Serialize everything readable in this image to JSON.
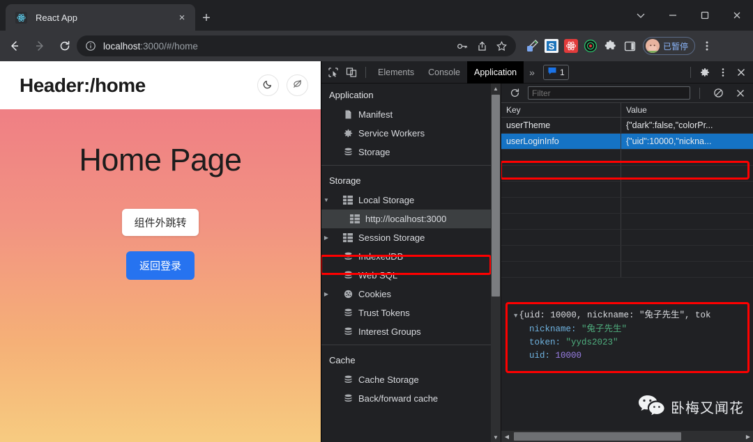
{
  "browser": {
    "tab": {
      "title": "React App",
      "favicon": "react-logo-icon",
      "close": "×"
    },
    "new_tab": "+",
    "window_controls": [
      "chevron-down",
      "minimize",
      "maximize",
      "close"
    ],
    "nav": {
      "back": "←",
      "forward": "→",
      "reload": "⟳"
    },
    "omnibox": {
      "info_icon": "info-circle-icon",
      "url_host": "localhost",
      "url_rest": ":3000/#/home",
      "icons": [
        "key-icon",
        "share-icon",
        "bookmark-star-icon"
      ]
    },
    "extensions": [
      "eyedropper-icon",
      "s-logo-icon",
      "react-devtools-icon",
      "target-icon",
      "puzzle-icon",
      "sidepanel-icon"
    ],
    "profile": {
      "label": "已暂停",
      "avatar": "avatar-icon"
    },
    "menu_icon": "kebab-menu-icon"
  },
  "page": {
    "header_title": "Header:/home",
    "header_buttons": [
      {
        "name": "dark-mode-toggle",
        "icon": "moon-icon"
      },
      {
        "name": "eco-toggle",
        "icon": "leaf-slash-icon"
      }
    ],
    "title": "Home Page",
    "button_outside": "组件外跳转",
    "button_login": "返回登录",
    "gradient_from": "#ef7f84",
    "gradient_to": "#f7cb80"
  },
  "devtools": {
    "toolbar_icons": [
      "inspect-cursor-icon",
      "device-toolbar-icon"
    ],
    "tabs": [
      {
        "label": "Elements",
        "active": false
      },
      {
        "label": "Console",
        "active": false
      },
      {
        "label": "Application",
        "active": true
      }
    ],
    "more_tabs": "»",
    "messages": {
      "icon": "message-icon",
      "count": "1"
    },
    "settings_icon": "gear-icon",
    "kebab_icon": "kebab-menu-icon",
    "close_icon": "close-icon",
    "sidebar": {
      "sections": [
        {
          "title": "Application",
          "items": [
            {
              "label": "Manifest",
              "icon": "manifest-file-icon",
              "arrow": "none",
              "indent": 1,
              "selected": false
            },
            {
              "label": "Service Workers",
              "icon": "gear-icon",
              "arrow": "none",
              "indent": 1,
              "selected": false
            },
            {
              "label": "Storage",
              "icon": "database-icon",
              "arrow": "none",
              "indent": 1,
              "selected": false
            }
          ]
        },
        {
          "title": "Storage",
          "items": [
            {
              "label": "Local Storage",
              "icon": "table-icon",
              "arrow": "expanded",
              "indent": 1,
              "selected": false
            },
            {
              "label": "http://localhost:3000",
              "icon": "table-icon",
              "arrow": "none",
              "indent": 2,
              "selected": true
            },
            {
              "label": "Session Storage",
              "icon": "table-icon",
              "arrow": "collapsed",
              "indent": 1,
              "selected": false
            },
            {
              "label": "IndexedDB",
              "icon": "database-icon",
              "arrow": "none",
              "indent": 1,
              "selected": false
            },
            {
              "label": "Web SQL",
              "icon": "database-icon",
              "arrow": "none",
              "indent": 1,
              "selected": false
            },
            {
              "label": "Cookies",
              "icon": "cookie-icon",
              "arrow": "collapsed",
              "indent": 1,
              "selected": false
            },
            {
              "label": "Trust Tokens",
              "icon": "database-icon",
              "arrow": "none",
              "indent": 1,
              "selected": false
            },
            {
              "label": "Interest Groups",
              "icon": "database-icon",
              "arrow": "none",
              "indent": 1,
              "selected": false
            }
          ]
        },
        {
          "title": "Cache",
          "items": [
            {
              "label": "Cache Storage",
              "icon": "database-icon",
              "arrow": "none",
              "indent": 1,
              "selected": false
            },
            {
              "label": "Back/forward cache",
              "icon": "database-icon",
              "arrow": "none",
              "indent": 1,
              "selected": false
            }
          ]
        }
      ]
    },
    "filterbar": {
      "refresh_icon": "refresh-icon",
      "filter_placeholder": "Filter",
      "filter_value": "",
      "clear_icon": "no-entry-icon",
      "delete_icon": "close-icon"
    },
    "table": {
      "columns": [
        "Key",
        "Value"
      ],
      "rows": [
        {
          "key": "userTheme",
          "value": "{\"dark\":false,\"colorPr...",
          "selected": false
        },
        {
          "key": "userLoginInfo",
          "value": "{\"uid\":10000,\"nickna...",
          "selected": true
        }
      ]
    },
    "preview": {
      "summary_prefix": "{uid: ",
      "summary_uid": "10000",
      "summary_mid": ", nickname: ",
      "summary_nick": "\"兔子先生\"",
      "summary_suffix": ", tok",
      "rows": [
        {
          "prop": "nickname:",
          "value": "\"兔子先生\"",
          "type": "string"
        },
        {
          "prop": "token:",
          "value": "\"yyds2023\"",
          "type": "string"
        },
        {
          "prop": "uid:",
          "value": "10000",
          "type": "number"
        }
      ]
    },
    "watermark": {
      "icon": "wechat-icon",
      "text": "卧梅又闻花"
    },
    "highlight_color": "#ff0000"
  }
}
